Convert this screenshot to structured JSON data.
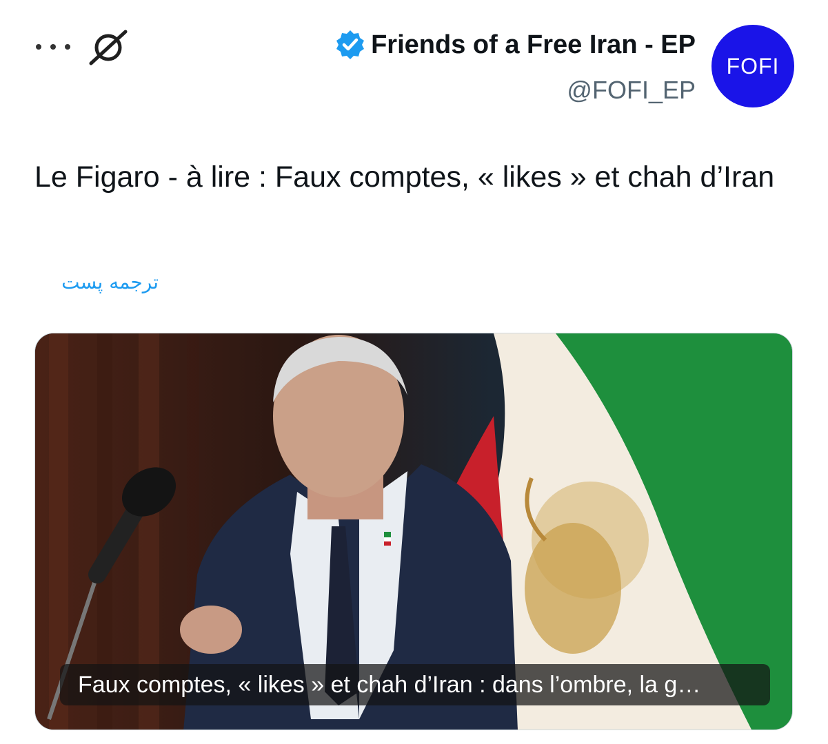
{
  "header": {
    "more_icon": "more-horizontal-icon",
    "grok_icon": "grok-icon",
    "display_name": "Friends of a Free Iran - EP",
    "verified_icon": "verified-badge-icon",
    "handle": "@FOFI_EP",
    "avatar_text": "FOFI"
  },
  "tweet": {
    "text": "Le Figaro - à lire : Faux comptes, « likes » et chah d’Iran",
    "translate_label": "ترجمه پست"
  },
  "media": {
    "caption": "Faux comptes, « likes » et chah d’Iran : dans l’ombre, la g…"
  },
  "colors": {
    "link": "#1d9bf0",
    "verified": "#1d9bf0",
    "avatar_bg": "#1a14e8",
    "text": "#0f1419",
    "secondary_text": "#536471"
  }
}
